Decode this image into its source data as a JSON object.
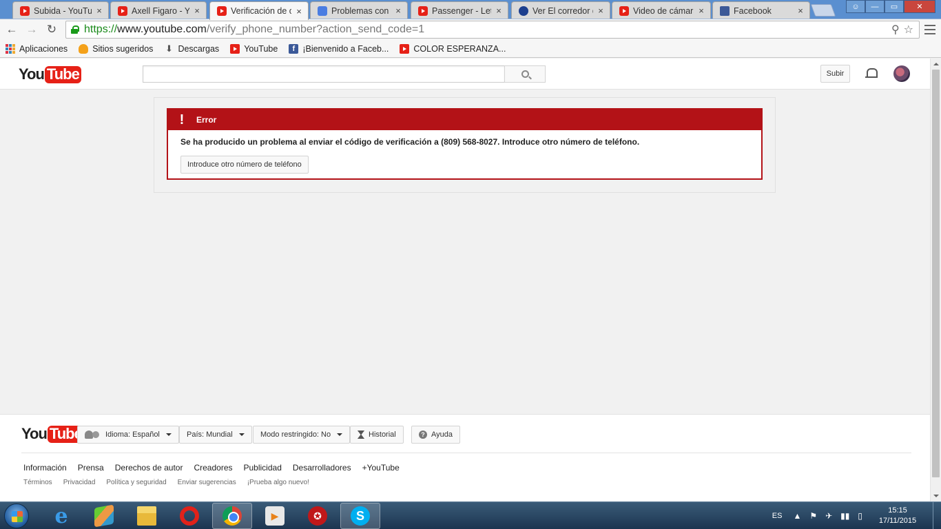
{
  "tabs": [
    {
      "label": "Subida - YouTube",
      "icon": "youtube-icon",
      "close": "×"
    },
    {
      "label": "Axell Figaro - YouTube",
      "icon": "youtube-icon",
      "close": "×"
    },
    {
      "label": "Verificación de cuenta",
      "icon": "youtube-icon",
      "close": "×",
      "active": true
    },
    {
      "label": "Problemas con verificación",
      "icon": "document-icon",
      "close": "×"
    },
    {
      "label": "Passenger - Let Her Go",
      "icon": "youtube-icon",
      "close": "×"
    },
    {
      "label": "Ver El corredor del laberinto",
      "icon": "globe-icon",
      "close": "×"
    },
    {
      "label": "Video de cámara web",
      "icon": "youtube-icon",
      "close": "×"
    },
    {
      "label": "Facebook",
      "icon": "facebook-icon",
      "close": "×"
    }
  ],
  "address_bar": {
    "scheme": "https://",
    "host": "www.youtube.com",
    "path": "/verify_phone_number?action_send_code=1"
  },
  "nav": {
    "back": "←",
    "forward": "→",
    "reload": "↻",
    "zoom": "⚲",
    "star": "☆"
  },
  "bookmarks": [
    {
      "label": "Aplicaciones",
      "icon": "apps-icon"
    },
    {
      "label": "Sitios sugeridos",
      "icon": "bulb-icon"
    },
    {
      "label": "Descargas",
      "icon": "download-icon"
    },
    {
      "label": "YouTube",
      "icon": "youtube-icon"
    },
    {
      "label": "¡Bienvenido a Faceb...",
      "icon": "facebook-icon"
    },
    {
      "label": "COLOR ESPERANZA...",
      "icon": "youtube-icon"
    }
  ],
  "masthead": {
    "logo_you": "You",
    "logo_tube": "Tube",
    "search_placeholder": "",
    "upload_label": "Subir"
  },
  "error": {
    "title": "Error",
    "symbol": "!",
    "message": "Se ha producido un problema al enviar el código de verificación a (809) 568-8027. Introduce otro número de teléfono.",
    "button_label": "Introduce otro número de teléfono"
  },
  "footer": {
    "logo_you": "You",
    "logo_tube": "Tube",
    "language_label": "Idioma: Español",
    "country_label": "País: Mundial",
    "restricted_label": "Modo restringido: No",
    "history_label": "Historial",
    "help_label": "Ayuda",
    "help_symbol": "?",
    "links": [
      "Información",
      "Prensa",
      "Derechos de autor",
      "Creadores",
      "Publicidad",
      "Desarrolladores",
      "+YouTube"
    ],
    "small_links": [
      "Términos",
      "Privacidad",
      "Política y seguridad",
      "Enviar sugerencias",
      "¡Prueba algo nuevo!"
    ]
  },
  "taskbar": {
    "apps": [
      {
        "name": "internet-explorer-icon",
        "glyph": "e"
      },
      {
        "name": "bluestacks-icon",
        "glyph": ""
      },
      {
        "name": "file-explorer-icon",
        "glyph": ""
      },
      {
        "name": "opera-icon",
        "glyph": ""
      },
      {
        "name": "chrome-icon",
        "glyph": "",
        "active": true
      },
      {
        "name": "video-player-icon",
        "glyph": "▶"
      },
      {
        "name": "game-booster-icon",
        "glyph": "✪"
      },
      {
        "name": "skype-icon",
        "glyph": "S"
      }
    ],
    "language": "ES",
    "tray_symbols": [
      "▲",
      "⚑",
      "✈",
      "▮▮",
      "▯"
    ],
    "time": "15:15",
    "date": "17/11/2015"
  },
  "colors": {
    "youtube_red": "#e62117",
    "error_red": "#b31217",
    "chrome_frame": "#5a8fd0"
  }
}
